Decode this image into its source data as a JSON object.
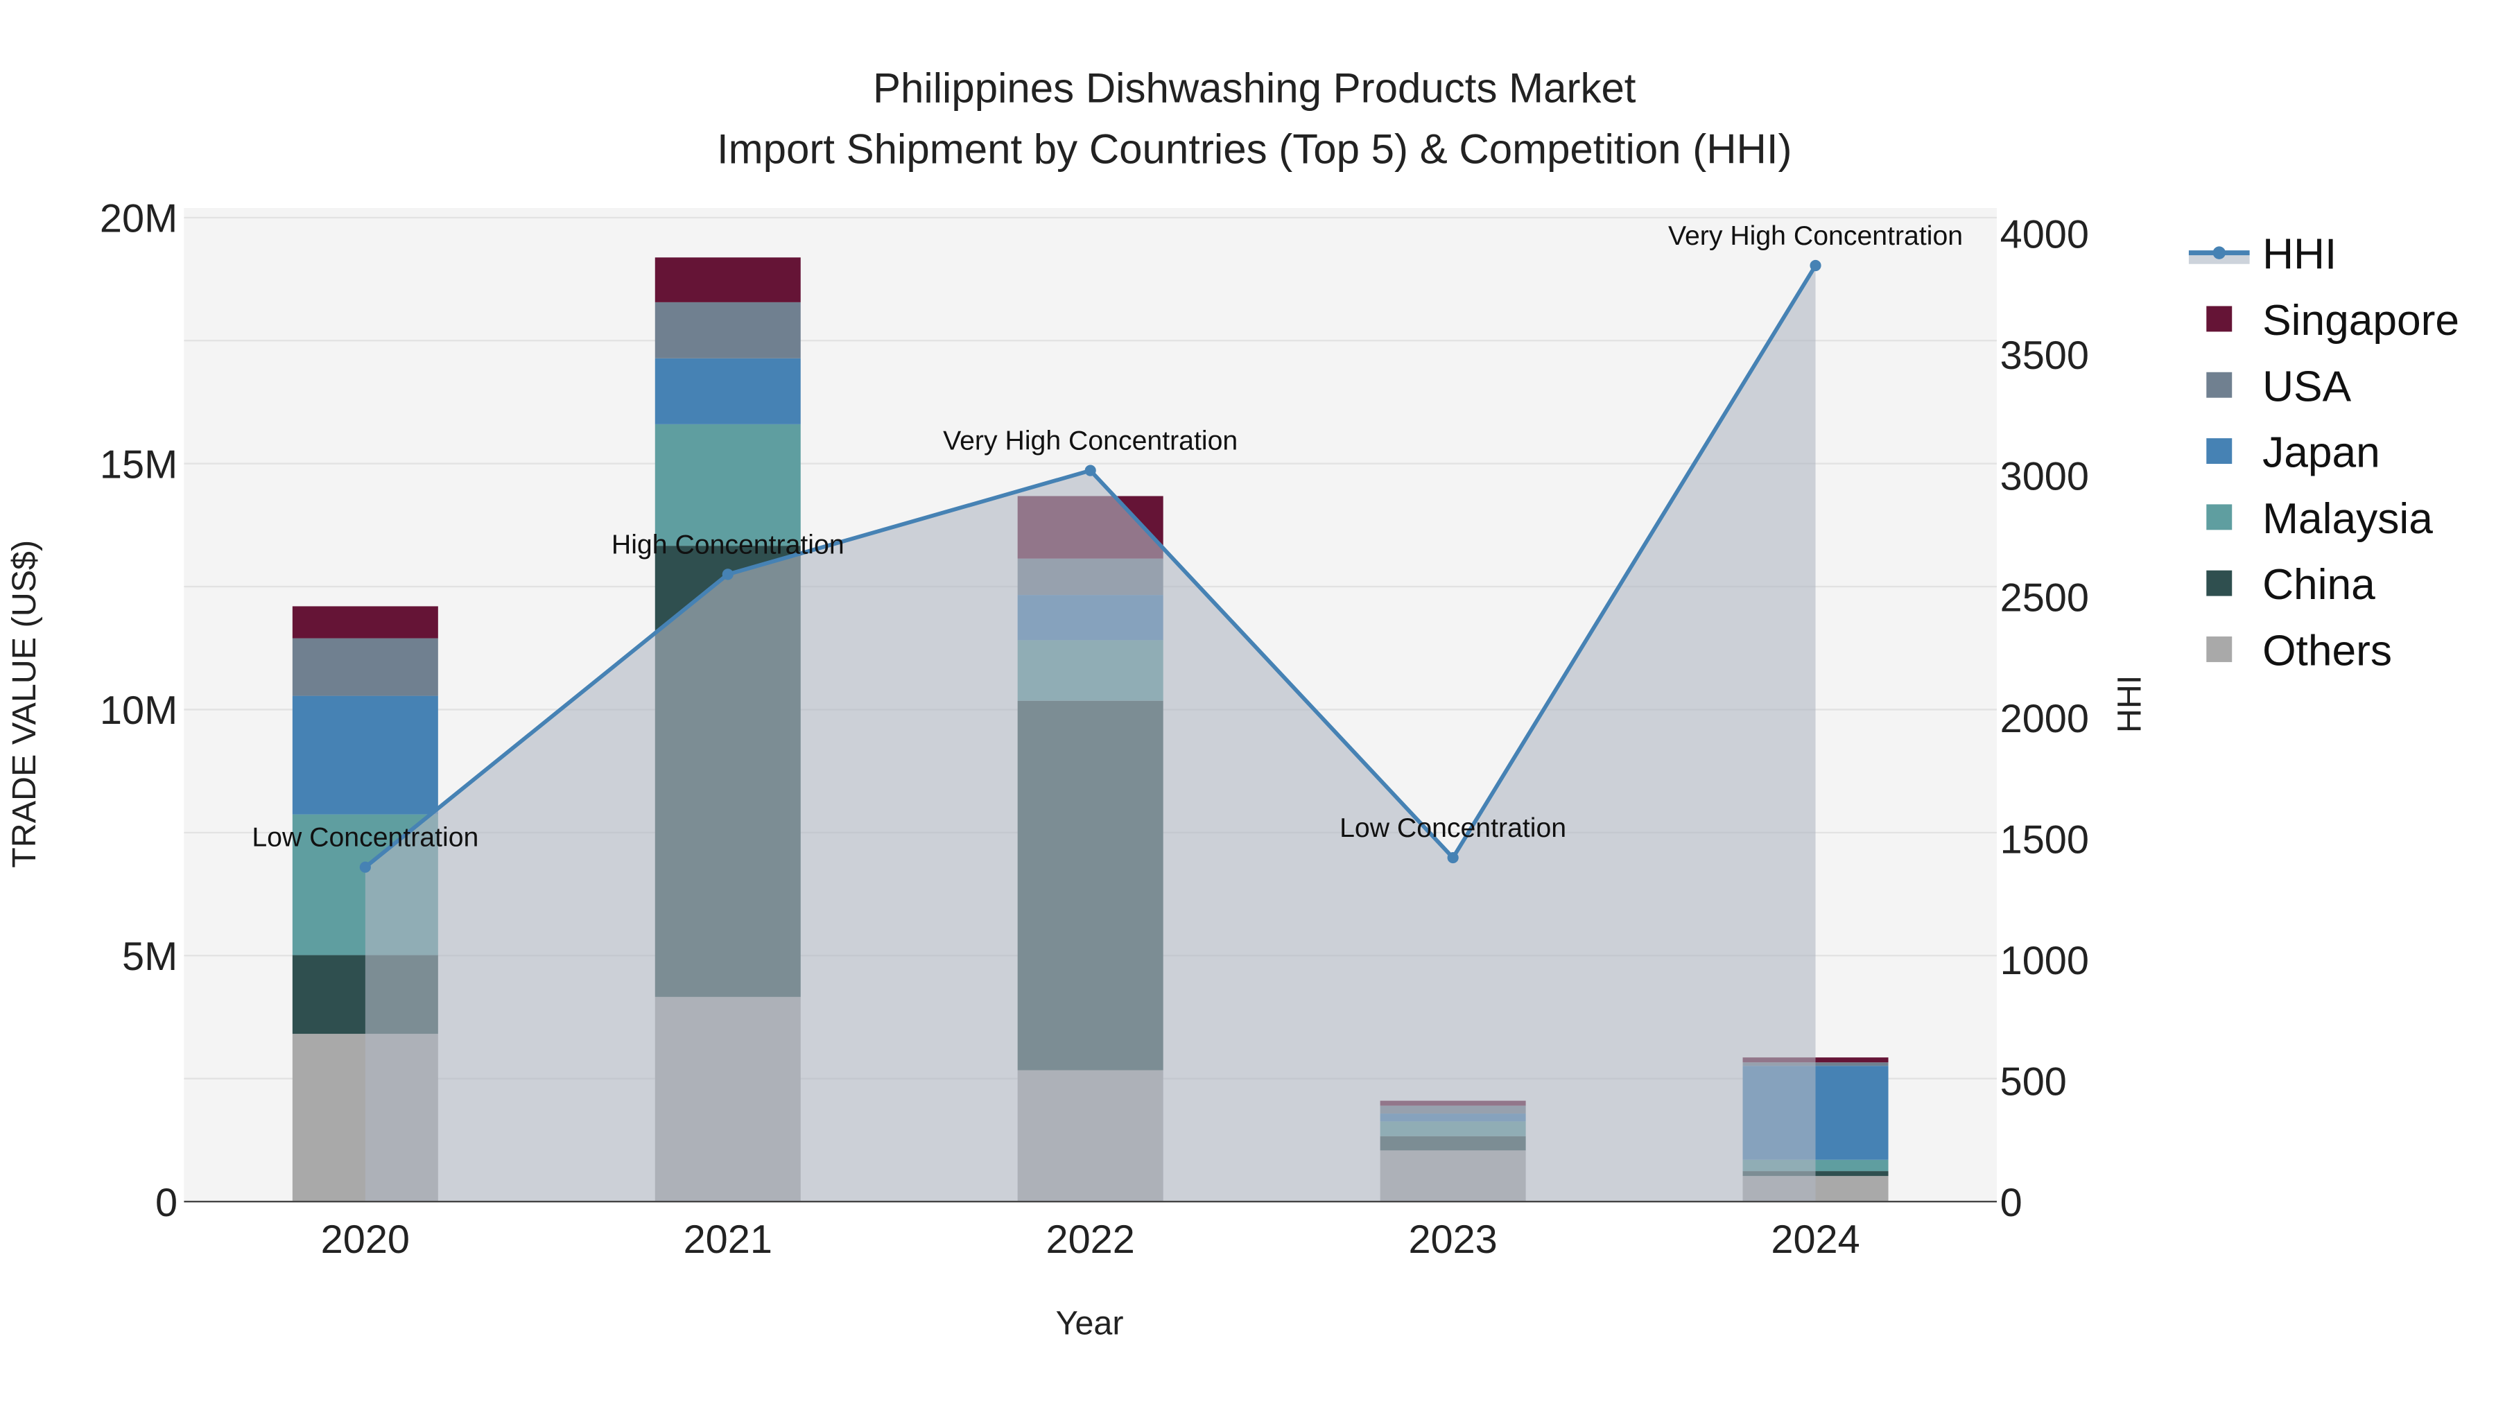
{
  "chart_data": {
    "type": "bar",
    "stacked": true,
    "title": "Philippines Dishwashing Products Market",
    "subtitle": "Import Shipment by Countries (Top 5) & Competition (HHI)",
    "xlabel": "Year",
    "ylabel": "TRADE VALUE (US$)",
    "y2label": "HHI",
    "categories": [
      "2020",
      "2021",
      "2022",
      "2023",
      "2024"
    ],
    "ylim": [
      0,
      20000000
    ],
    "y2lim": [
      0,
      4000
    ],
    "yticks": [
      0,
      5000000,
      10000000,
      15000000,
      20000000
    ],
    "ytick_labels": [
      "0",
      "5M",
      "10M",
      "15M",
      "20M"
    ],
    "y2ticks": [
      0,
      500,
      1000,
      1500,
      2000,
      2500,
      3000,
      3500,
      4000
    ],
    "y2tick_labels": [
      "0",
      "500",
      "1000",
      "1500",
      "2000",
      "2500",
      "3000",
      "3500",
      "4000"
    ],
    "legend_position": "right",
    "series": [
      {
        "name": "Others",
        "color": "#a9a9a9",
        "values": [
          3410000,
          4160000,
          2670000,
          1040000,
          520000
        ]
      },
      {
        "name": "China",
        "color": "#2f4f4f",
        "values": [
          1600000,
          9170000,
          7510000,
          290000,
          100000
        ]
      },
      {
        "name": "Malaysia",
        "color": "#5f9ea0",
        "values": [
          2860000,
          2470000,
          1230000,
          300000,
          230000
        ]
      },
      {
        "name": "Japan",
        "color": "#4682b4",
        "values": [
          2410000,
          1340000,
          920000,
          160000,
          1910000
        ]
      },
      {
        "name": "USA",
        "color": "#708090",
        "values": [
          1170000,
          1140000,
          740000,
          160000,
          70000
        ]
      },
      {
        "name": "Singapore",
        "color": "#651436",
        "values": [
          650000,
          910000,
          1270000,
          100000,
          100000
        ]
      }
    ],
    "hhi": {
      "name": "HHI",
      "color": "#4682b4",
      "fill": "#b0b7c3",
      "values": [
        1382,
        2592,
        3021,
        1421,
        3868
      ],
      "annotations": [
        "Low Concentration",
        "High Concentration",
        "Very High Concentration",
        "Low Concentration",
        "Very High Concentration"
      ]
    },
    "legend_order": [
      "HHI",
      "Singapore",
      "USA",
      "Japan",
      "Malaysia",
      "China",
      "Others"
    ]
  }
}
